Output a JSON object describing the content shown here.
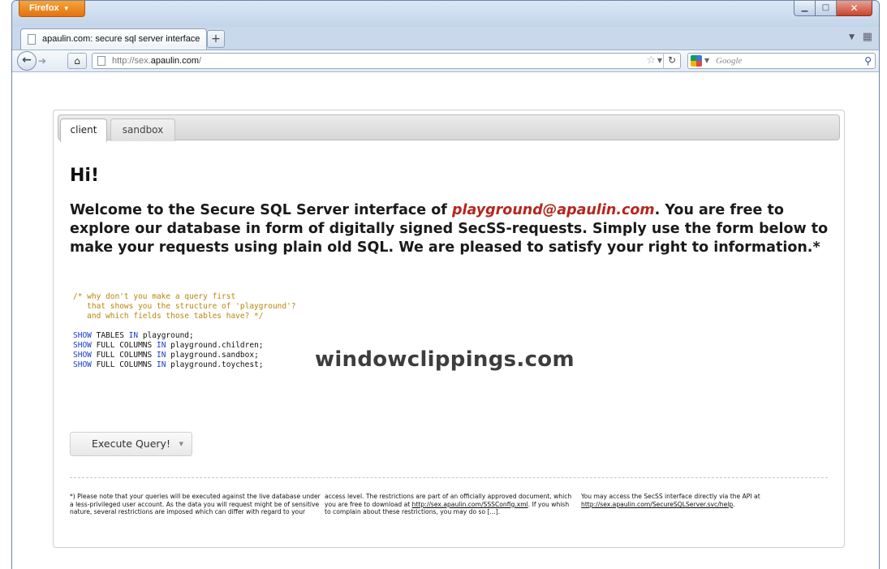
{
  "browser": {
    "menu_button": "Firefox",
    "menu_arrow": "▼",
    "tab_title": "apaulin.com: secure sql server interface",
    "new_tab": "+",
    "url_prefix": "http://sex.",
    "url_domain": "apaulin.com",
    "url_suffix": "/",
    "search_placeholder": "Google",
    "window_controls": {
      "minimize": "▁",
      "maximize": "□",
      "close": "✕"
    }
  },
  "page": {
    "tabs": [
      {
        "label": "client"
      },
      {
        "label": "sandbox"
      }
    ],
    "greeting": "Hi!",
    "welcome_before": "Welcome to the Secure SQL Server interface of ",
    "welcome_account": "playground@apaulin.com",
    "welcome_after": ". You are free to explore our database in form of digitally signed SecSS-requests. Simply use the form below to make your requests using plain old SQL. We are pleased to satisfy your right to information.*",
    "code": {
      "comment": [
        "/* why don't you make a query first",
        "   that shows you the structure of 'playground'?",
        "   and which fields those tables have? */"
      ],
      "statements": [
        {
          "kw1": "SHOW",
          "mid": " TABLES ",
          "kw2": "IN",
          "rest": " playground;"
        },
        {
          "kw1": "SHOW",
          "mid": " FULL COLUMNS ",
          "kw2": "IN",
          "rest": " playground.children;"
        },
        {
          "kw1": "SHOW",
          "mid": " FULL COLUMNS ",
          "kw2": "IN",
          "rest": " playground.sandbox;"
        },
        {
          "kw1": "SHOW",
          "mid": " FULL COLUMNS ",
          "kw2": "IN",
          "rest": " playground.toychest;"
        }
      ]
    },
    "watermark": "windowclippings.com",
    "execute_button": "Execute Query!",
    "footnotes": {
      "col1": "*) Please note that your queries will be executed against the live database under a less-privileged user account. As the data you will request might be of sensitive nature, several restrictions are imposed which can differ with regard to your",
      "col2_before": "access level. The restrictions are part of an officially approved document, which you are free to download at ",
      "col2_link": "http://sex.apaulin.com/SSSConfig.xml",
      "col2_after": ". If you whish to complain about these restrictions, you may do so [...].",
      "col3_before": "You may access the SecSS interface directly via the API at ",
      "col3_link": "http://sex.apaulin.com/SecureSQLServer.svc/help",
      "col3_after": "."
    }
  },
  "colors": {
    "account_highlight": "#b5261e",
    "sql_keyword": "#1a3ccf",
    "sql_comment": "#b8860b",
    "firefox_orange": "#e3720f"
  }
}
